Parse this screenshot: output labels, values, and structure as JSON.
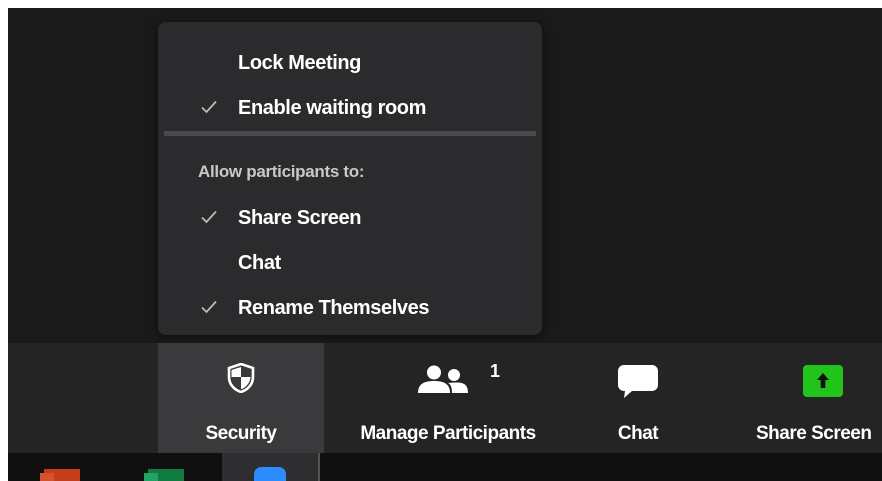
{
  "security_menu": {
    "items": [
      {
        "label": "Lock Meeting",
        "checked": false
      },
      {
        "label": "Enable waiting room",
        "checked": true
      }
    ],
    "section_title": "Allow participants to:",
    "participant_items": [
      {
        "label": "Share Screen",
        "checked": true
      },
      {
        "label": "Chat",
        "checked": false
      },
      {
        "label": "Rename Themselves",
        "checked": true
      }
    ]
  },
  "toolbar": {
    "security_label": "Security",
    "security_icon": "shield-icon",
    "participants_label": "Manage Participants",
    "participants_icon": "participants-icon",
    "participants_count": "1",
    "chat_label": "Chat",
    "chat_icon": "chat-bubble-icon",
    "share_label": "Share Screen",
    "share_icon": "share-screen-icon",
    "share_color": "#22c31b"
  },
  "taskbar": {
    "apps": [
      "powerpoint-icon",
      "excel-icon",
      "zoom-icon"
    ]
  }
}
